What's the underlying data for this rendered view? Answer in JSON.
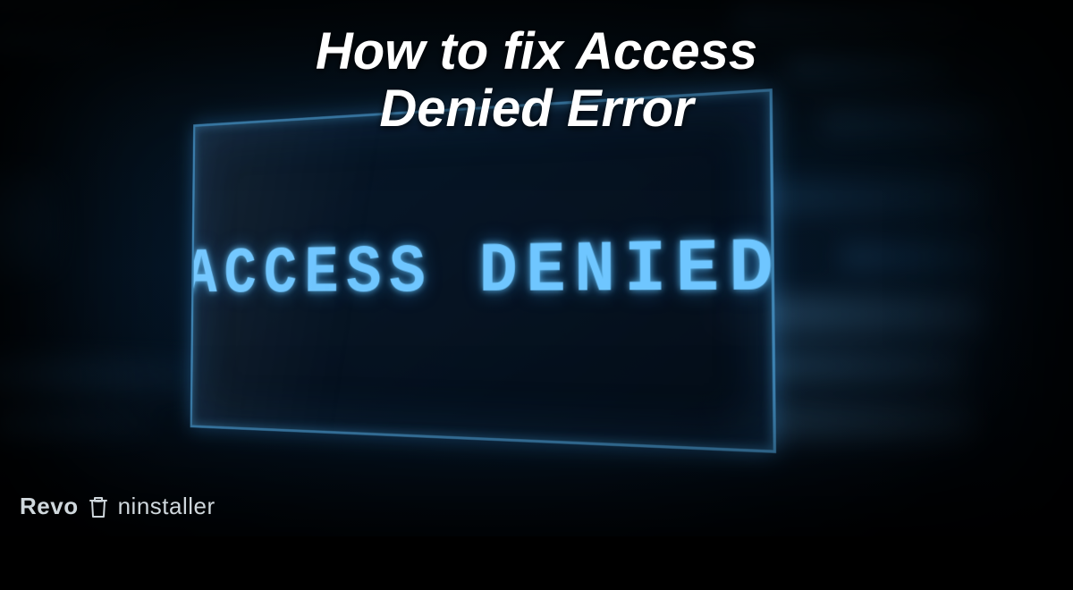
{
  "title_line1": "How to fix Access",
  "title_line2": "Denied Error",
  "terminal_text": "ACCESS DENIED",
  "brand": {
    "word1": "Revo",
    "word2": "ninstaller"
  },
  "colors": {
    "accent": "#6fc6ff",
    "title": "#ffffff",
    "brand": "#cfd7dc"
  }
}
